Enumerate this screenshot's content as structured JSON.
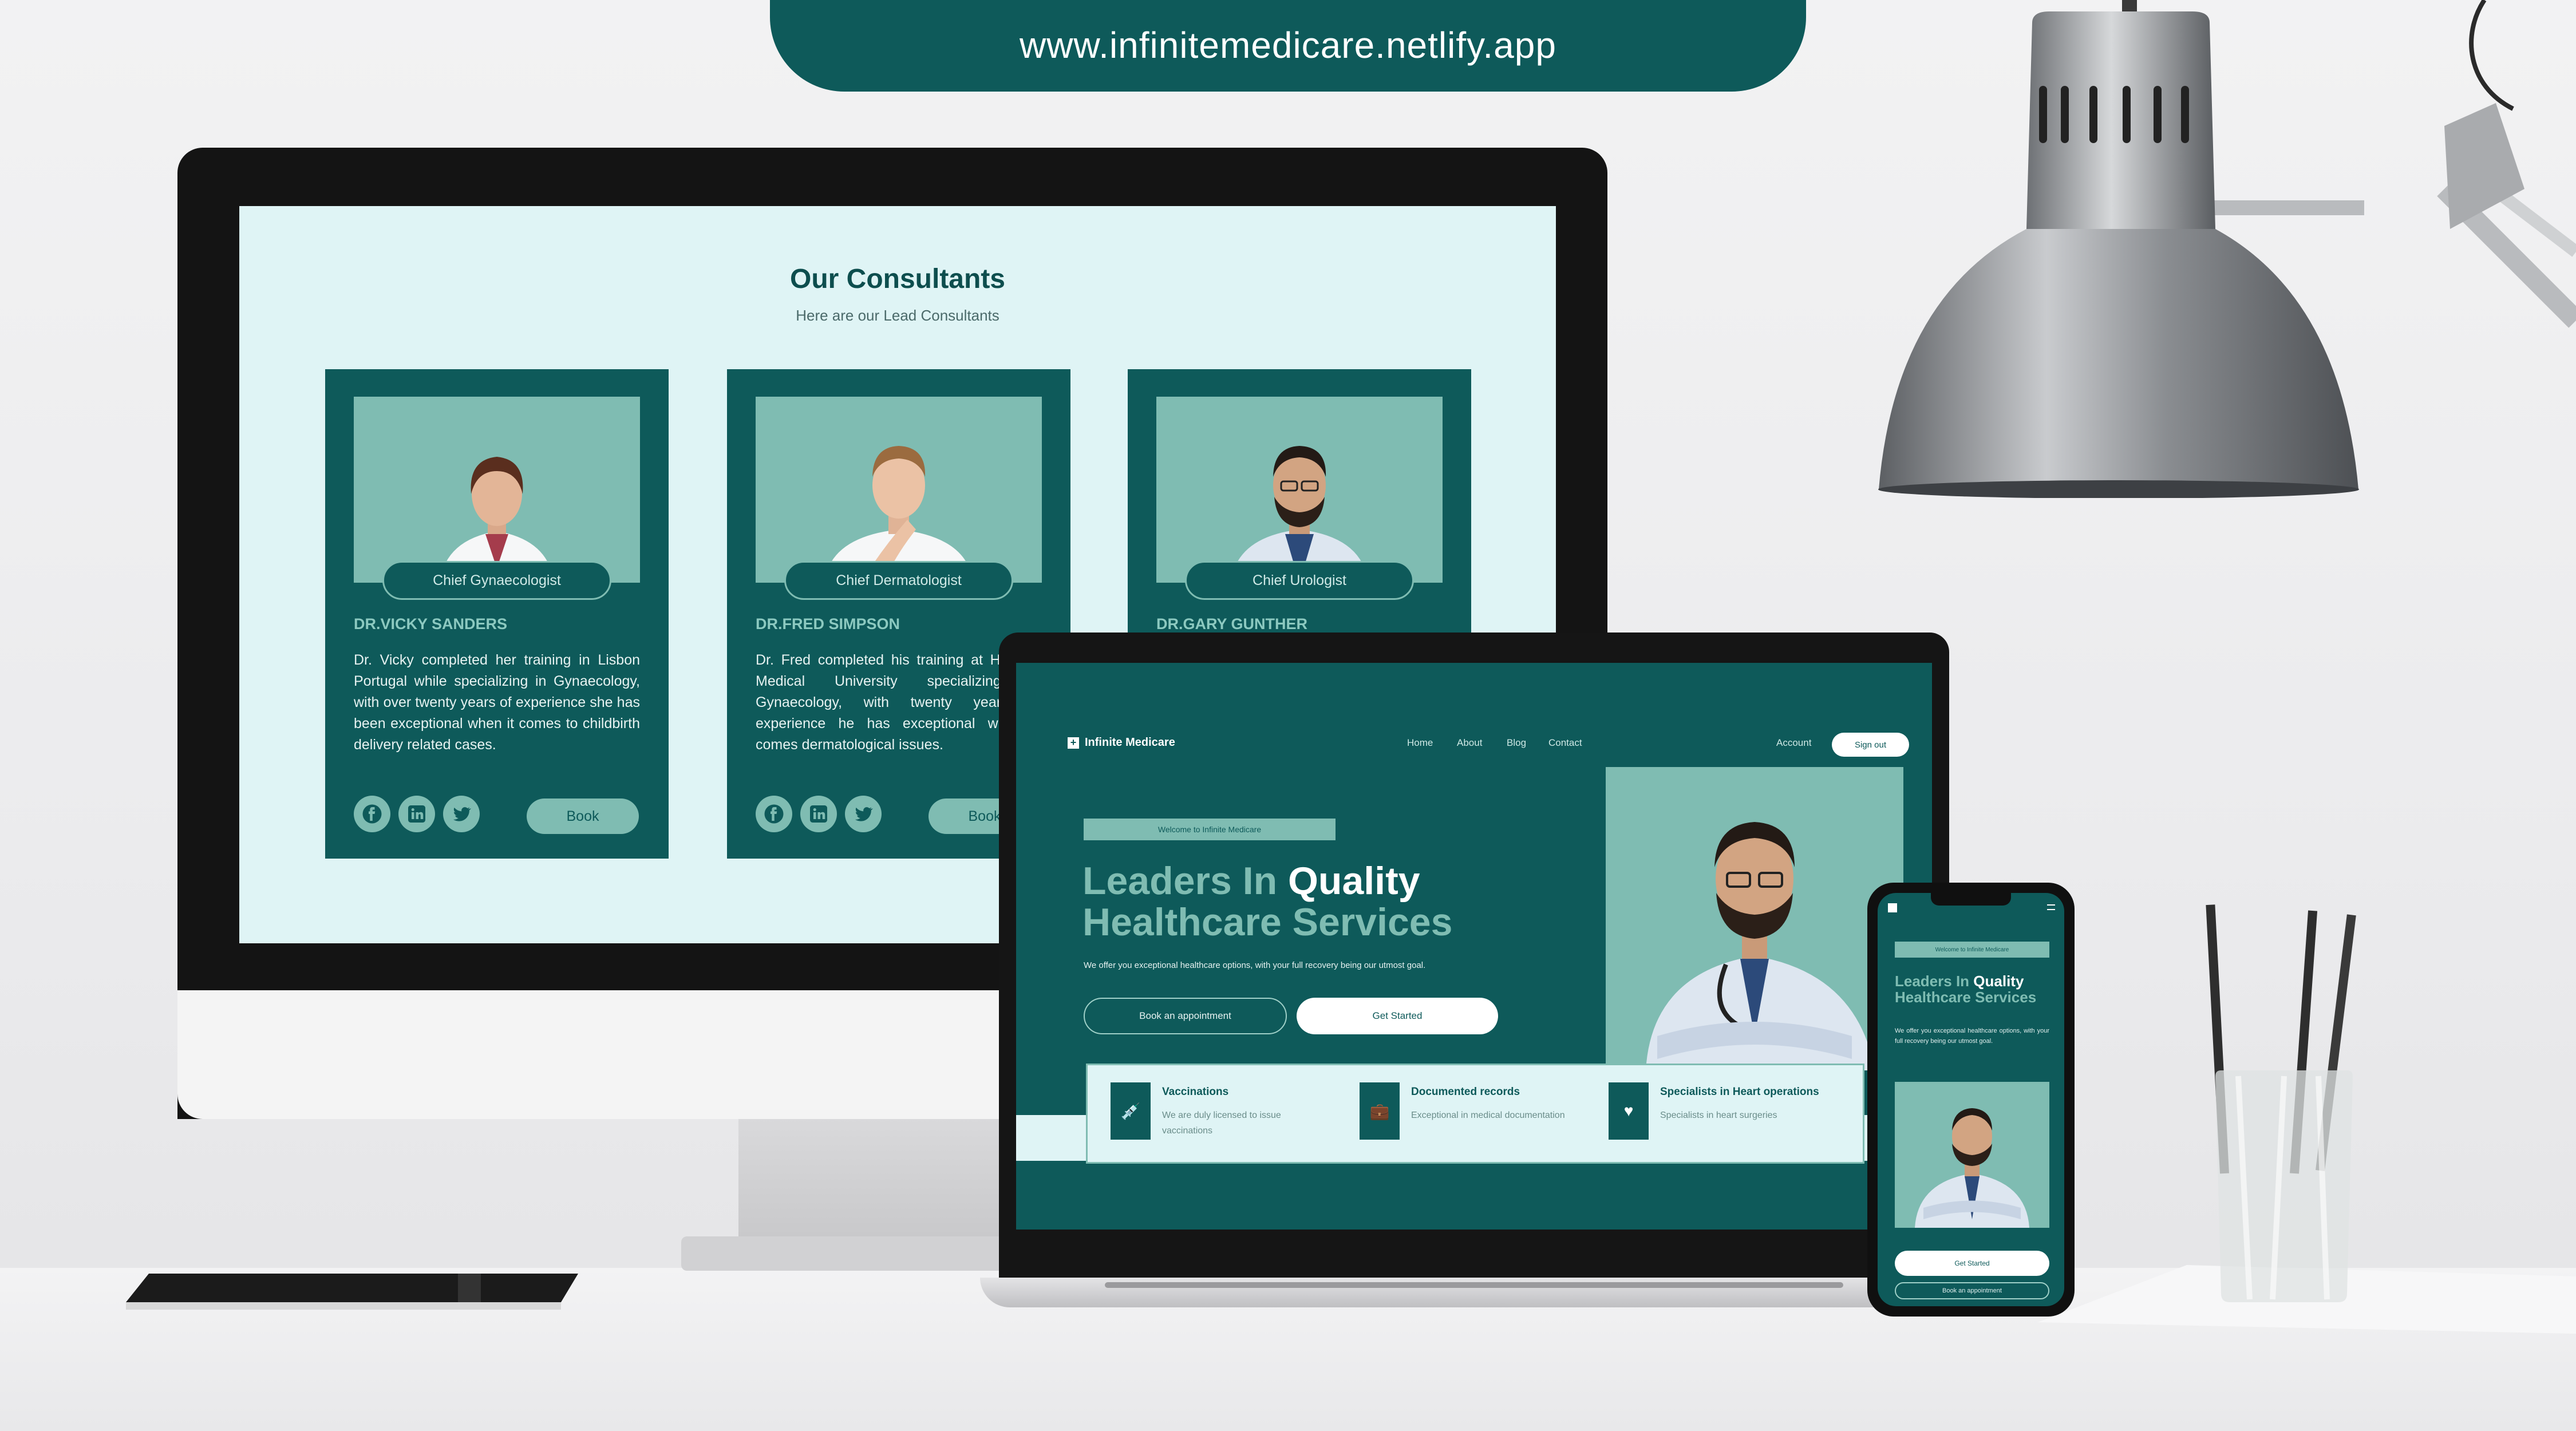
{
  "banner": {
    "url": "www.infinitemedicare.netlify.app"
  },
  "monitor": {
    "section_title": "Our Consultants",
    "section_subtitle": "Here are our Lead Consultants",
    "cards": [
      {
        "role": "Chief Gynaecologist",
        "name": "DR.VICKY SANDERS",
        "bio": "Dr. Vicky completed her training in Lisbon Portugal while specializing in Gynaecology, with over twenty years of experience she has been exceptional when it comes to childbirth delivery related cases.",
        "book": "Book"
      },
      {
        "role": "Chief Dermatologist",
        "name": "DR.FRED SIMPSON",
        "bio": "Dr. Fred completed his training at Hopkins Medical University specializing in Gynaecology, with twenty years of experience he has exceptional when it comes dermatological issues.",
        "book": "Book"
      },
      {
        "role": "Chief Urologist",
        "name": "DR.GARY GUNTHER",
        "bio": "",
        "book": "Book"
      }
    ],
    "social_icons": [
      "facebook-icon",
      "linkedin-icon",
      "twitter-icon"
    ]
  },
  "laptop": {
    "brand": "Infinite Medicare",
    "nav": [
      "Home",
      "About",
      "Blog",
      "Contact"
    ],
    "account": "Account",
    "signout": "Sign out",
    "welcome": "Welcome to Infinite Medicare",
    "headline_1a": "Leaders In ",
    "headline_1b": "Quality",
    "headline_2": "Healthcare Services",
    "intro": "We offer you exceptional healthcare options, with your full recovery being our utmost goal.",
    "btn_book": "Book an appointment",
    "btn_start": "Get Started",
    "features": [
      {
        "title": "Vaccinations",
        "desc": "We are duly licensed to issue vaccinations",
        "icon": "syringe-icon"
      },
      {
        "title": "Documented records",
        "desc": "Exceptional in medical documentation",
        "icon": "briefcase-icon"
      },
      {
        "title": "Specialists in Heart operations",
        "desc": "Specialists in heart surgeries",
        "icon": "heart-monitor-icon"
      }
    ]
  },
  "phone": {
    "welcome": "Welcome to Infinite Medicare",
    "headline_1a": "Leaders In ",
    "headline_1b": "Quality",
    "headline_2": "Healthcare Services",
    "intro": "We offer you exceptional healthcare options, with your full recovery being our utmost goal.",
    "btn_start": "Get Started",
    "btn_book": "Book an appointment"
  },
  "colors": {
    "brand_teal": "#0e5a5a",
    "accent_mint": "#7fbcb2",
    "light_bg": "#dff4f5"
  }
}
